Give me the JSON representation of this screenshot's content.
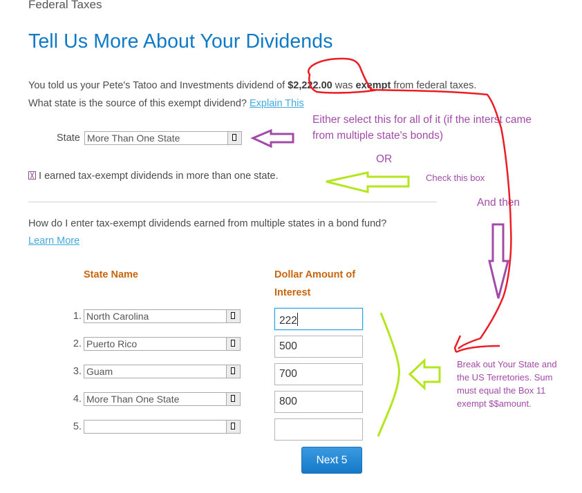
{
  "header": {
    "section_title": "Federal Taxes",
    "page_title": "Tell Us More About Your Dividends"
  },
  "intro": {
    "line1_prefix": "You told us your Pete's Tatoo and Investments dividend of ",
    "amount": "$2,222.00",
    "line1_mid": " was ",
    "exempt_word": "exempt",
    "line1_suffix": " from federal taxes.",
    "line2": "What state is the source of this exempt dividend? ",
    "explain_link": "Explain This"
  },
  "state_select": {
    "label": "State",
    "value": "More Than One State"
  },
  "multi_state_checkbox": {
    "label": "I earned tax-exempt dividends in more than one state.",
    "checked": true
  },
  "help": {
    "question": "How do I enter tax-exempt dividends earned from multiple states in a bond fund?",
    "learn_more": "Learn More"
  },
  "table": {
    "col_state": "State Name",
    "col_amount_line1": "Dollar Amount of",
    "col_amount_line2": "Interest",
    "rows": [
      {
        "num": "1.",
        "state": "North Carolina",
        "amount": "222"
      },
      {
        "num": "2.",
        "state": "Puerto Rico",
        "amount": "500"
      },
      {
        "num": "3.",
        "state": "Guam",
        "amount": "700"
      },
      {
        "num": "4.",
        "state": "More Than One State",
        "amount": "800"
      },
      {
        "num": "5.",
        "state": "",
        "amount": ""
      }
    ],
    "next_button": "Next 5"
  },
  "annotations": {
    "either_line1": "Either select this for all of it  (if the interst came",
    "either_line2": "from multiple state's bonds)",
    "or": "OR",
    "check_box": "Check this box",
    "and_then": "And then",
    "break_out_lines": [
      "Break out Your State and",
      "the US Terretories.  Sum",
      "must equal the Box  11",
      "exempt $$amount."
    ],
    "colors": {
      "purple": "#a24aa8",
      "green": "#b5e61d",
      "red": "#ed1c24"
    }
  }
}
